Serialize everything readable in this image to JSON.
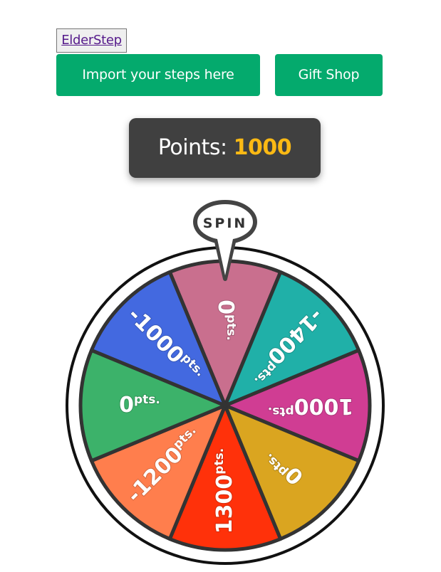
{
  "header": {
    "brand": "ElderStep",
    "import_button": "Import your steps here",
    "gift_button": "Gift Shop"
  },
  "points": {
    "label": "Points:",
    "value": "1000"
  },
  "spinner": {
    "spin_label": "SPIN",
    "segments": [
      {
        "value": "0",
        "unit": "pts.",
        "color": "#c96f8e"
      },
      {
        "value": "-1400",
        "unit": "pts.",
        "color": "#20b0a8"
      },
      {
        "value": "1000",
        "unit": "pts.",
        "color": "#d03d93"
      },
      {
        "value": "0",
        "unit": "pts.",
        "color": "#daa520"
      },
      {
        "value": "1300",
        "unit": "pts.",
        "color": "#ff310a"
      },
      {
        "value": "-1200",
        "unit": "pts.",
        "color": "#ff7e4d"
      },
      {
        "value": "0",
        "unit": "pts.",
        "color": "#3cb26a"
      },
      {
        "value": "-1000",
        "unit": "pts.",
        "color": "#4369e0"
      }
    ]
  }
}
